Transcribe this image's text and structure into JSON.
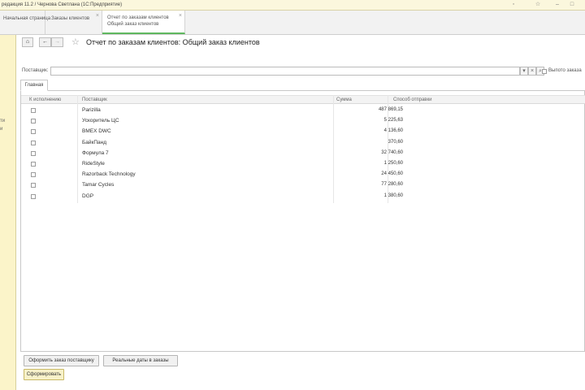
{
  "window": {
    "title": "редакция 11.2 / Чернова Светлана (1С:Предприятие)"
  },
  "tabs": [
    {
      "label": "Начальная страница"
    },
    {
      "label": "Заказы клиентов"
    },
    {
      "label_line1": "Отчет по заказам клиентов",
      "label_line2": "Общий заказ клиентов"
    }
  ],
  "left_panel": {
    "text_line1": "ти",
    "text_line2": "и"
  },
  "toolbar": {
    "home": "⌂",
    "back": "←",
    "forward": "→",
    "title": "Отчет по заказам клиентов: Общий заказ клиентов"
  },
  "filter": {
    "supplier_label": "Поставщик:",
    "supplier_value": "",
    "show_orders_label": "Выпото заказа"
  },
  "subtab": {
    "label": "Главная"
  },
  "table": {
    "columns": [
      "К исполнению",
      "Поставщик",
      "Сумма",
      "Способ отправки"
    ],
    "rows": [
      {
        "checked": false,
        "supplier": "Parizilla",
        "sum": "487 869,15"
      },
      {
        "checked": false,
        "supplier": "Ускоритель ЦС",
        "sum": "5 225,63"
      },
      {
        "checked": false,
        "supplier": "BMEX DWC",
        "sum": "4 136,60"
      },
      {
        "checked": false,
        "supplier": "БайкПанд",
        "sum": "370,60"
      },
      {
        "checked": false,
        "supplier": "Формула 7",
        "sum": "32 740,60"
      },
      {
        "checked": false,
        "supplier": "RideStyle",
        "sum": "1 250,60"
      },
      {
        "checked": false,
        "supplier": "Razorback Technology",
        "sum": "24 450,60"
      },
      {
        "checked": false,
        "supplier": "Tamar Cycles",
        "sum": "77 280,60"
      },
      {
        "checked": false,
        "supplier": "DGP",
        "sum": "1 380,60"
      }
    ]
  },
  "buttons": {
    "place_order": "Оформить заказ поставщику",
    "real_dates": "Реальные даты в заказы",
    "generate": "Сформировать"
  }
}
